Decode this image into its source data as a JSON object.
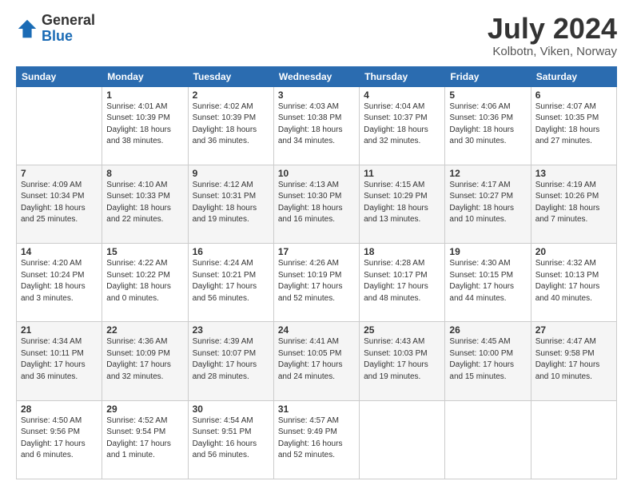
{
  "logo": {
    "general": "General",
    "blue": "Blue"
  },
  "title": "July 2024",
  "location": "Kolbotn, Viken, Norway",
  "weekdays": [
    "Sunday",
    "Monday",
    "Tuesday",
    "Wednesday",
    "Thursday",
    "Friday",
    "Saturday"
  ],
  "weeks": [
    [
      {
        "day": "",
        "info": ""
      },
      {
        "day": "1",
        "info": "Sunrise: 4:01 AM\nSunset: 10:39 PM\nDaylight: 18 hours\nand 38 minutes."
      },
      {
        "day": "2",
        "info": "Sunrise: 4:02 AM\nSunset: 10:39 PM\nDaylight: 18 hours\nand 36 minutes."
      },
      {
        "day": "3",
        "info": "Sunrise: 4:03 AM\nSunset: 10:38 PM\nDaylight: 18 hours\nand 34 minutes."
      },
      {
        "day": "4",
        "info": "Sunrise: 4:04 AM\nSunset: 10:37 PM\nDaylight: 18 hours\nand 32 minutes."
      },
      {
        "day": "5",
        "info": "Sunrise: 4:06 AM\nSunset: 10:36 PM\nDaylight: 18 hours\nand 30 minutes."
      },
      {
        "day": "6",
        "info": "Sunrise: 4:07 AM\nSunset: 10:35 PM\nDaylight: 18 hours\nand 27 minutes."
      }
    ],
    [
      {
        "day": "7",
        "info": "Sunrise: 4:09 AM\nSunset: 10:34 PM\nDaylight: 18 hours\nand 25 minutes."
      },
      {
        "day": "8",
        "info": "Sunrise: 4:10 AM\nSunset: 10:33 PM\nDaylight: 18 hours\nand 22 minutes."
      },
      {
        "day": "9",
        "info": "Sunrise: 4:12 AM\nSunset: 10:31 PM\nDaylight: 18 hours\nand 19 minutes."
      },
      {
        "day": "10",
        "info": "Sunrise: 4:13 AM\nSunset: 10:30 PM\nDaylight: 18 hours\nand 16 minutes."
      },
      {
        "day": "11",
        "info": "Sunrise: 4:15 AM\nSunset: 10:29 PM\nDaylight: 18 hours\nand 13 minutes."
      },
      {
        "day": "12",
        "info": "Sunrise: 4:17 AM\nSunset: 10:27 PM\nDaylight: 18 hours\nand 10 minutes."
      },
      {
        "day": "13",
        "info": "Sunrise: 4:19 AM\nSunset: 10:26 PM\nDaylight: 18 hours\nand 7 minutes."
      }
    ],
    [
      {
        "day": "14",
        "info": "Sunrise: 4:20 AM\nSunset: 10:24 PM\nDaylight: 18 hours\nand 3 minutes."
      },
      {
        "day": "15",
        "info": "Sunrise: 4:22 AM\nSunset: 10:22 PM\nDaylight: 18 hours\nand 0 minutes."
      },
      {
        "day": "16",
        "info": "Sunrise: 4:24 AM\nSunset: 10:21 PM\nDaylight: 17 hours\nand 56 minutes."
      },
      {
        "day": "17",
        "info": "Sunrise: 4:26 AM\nSunset: 10:19 PM\nDaylight: 17 hours\nand 52 minutes."
      },
      {
        "day": "18",
        "info": "Sunrise: 4:28 AM\nSunset: 10:17 PM\nDaylight: 17 hours\nand 48 minutes."
      },
      {
        "day": "19",
        "info": "Sunrise: 4:30 AM\nSunset: 10:15 PM\nDaylight: 17 hours\nand 44 minutes."
      },
      {
        "day": "20",
        "info": "Sunrise: 4:32 AM\nSunset: 10:13 PM\nDaylight: 17 hours\nand 40 minutes."
      }
    ],
    [
      {
        "day": "21",
        "info": "Sunrise: 4:34 AM\nSunset: 10:11 PM\nDaylight: 17 hours\nand 36 minutes."
      },
      {
        "day": "22",
        "info": "Sunrise: 4:36 AM\nSunset: 10:09 PM\nDaylight: 17 hours\nand 32 minutes."
      },
      {
        "day": "23",
        "info": "Sunrise: 4:39 AM\nSunset: 10:07 PM\nDaylight: 17 hours\nand 28 minutes."
      },
      {
        "day": "24",
        "info": "Sunrise: 4:41 AM\nSunset: 10:05 PM\nDaylight: 17 hours\nand 24 minutes."
      },
      {
        "day": "25",
        "info": "Sunrise: 4:43 AM\nSunset: 10:03 PM\nDaylight: 17 hours\nand 19 minutes."
      },
      {
        "day": "26",
        "info": "Sunrise: 4:45 AM\nSunset: 10:00 PM\nDaylight: 17 hours\nand 15 minutes."
      },
      {
        "day": "27",
        "info": "Sunrise: 4:47 AM\nSunset: 9:58 PM\nDaylight: 17 hours\nand 10 minutes."
      }
    ],
    [
      {
        "day": "28",
        "info": "Sunrise: 4:50 AM\nSunset: 9:56 PM\nDaylight: 17 hours\nand 6 minutes."
      },
      {
        "day": "29",
        "info": "Sunrise: 4:52 AM\nSunset: 9:54 PM\nDaylight: 17 hours\nand 1 minute."
      },
      {
        "day": "30",
        "info": "Sunrise: 4:54 AM\nSunset: 9:51 PM\nDaylight: 16 hours\nand 56 minutes."
      },
      {
        "day": "31",
        "info": "Sunrise: 4:57 AM\nSunset: 9:49 PM\nDaylight: 16 hours\nand 52 minutes."
      },
      {
        "day": "",
        "info": ""
      },
      {
        "day": "",
        "info": ""
      },
      {
        "day": "",
        "info": ""
      }
    ]
  ]
}
